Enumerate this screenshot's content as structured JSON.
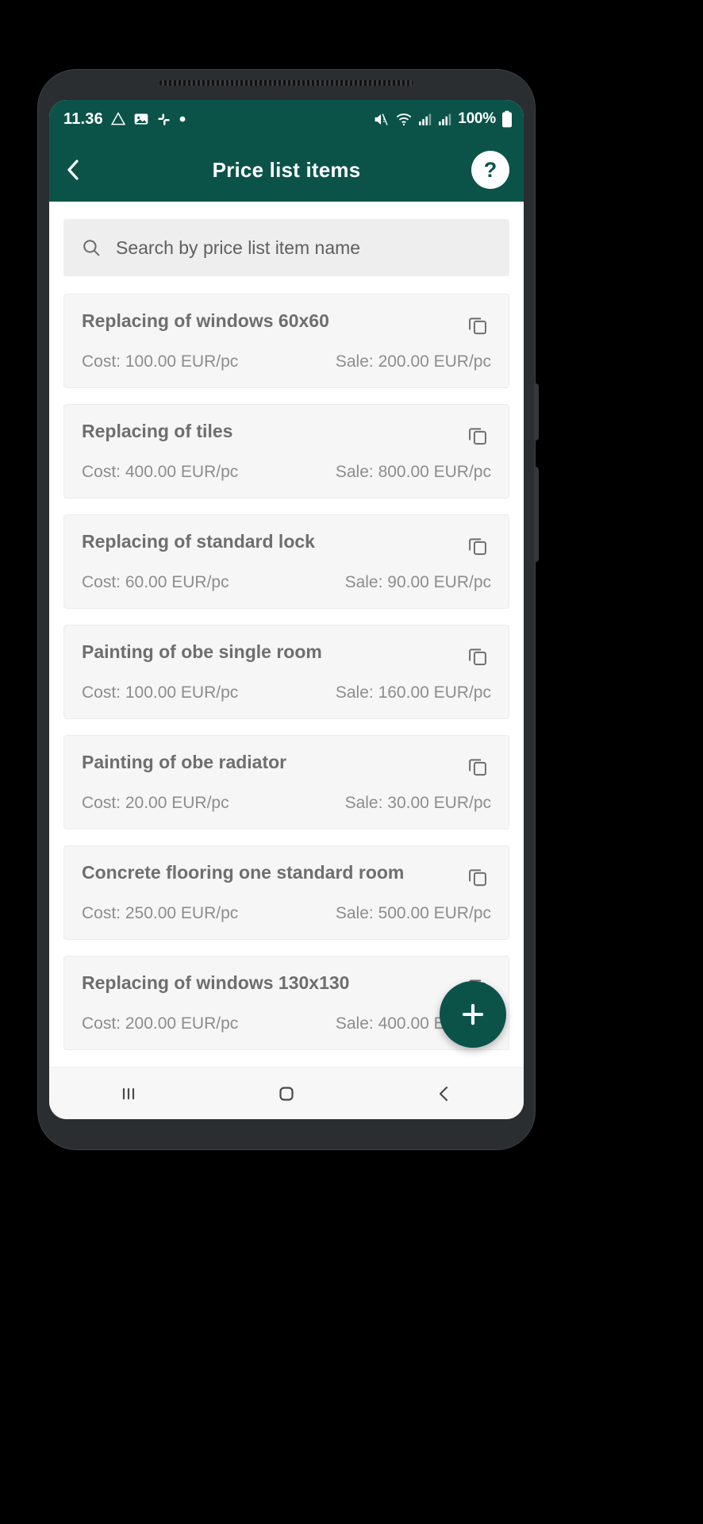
{
  "status_bar": {
    "clock": "11.36",
    "battery_percent": "100%",
    "left_icons": [
      "drive-icon",
      "photos-icon",
      "slack-icon",
      "dot-icon"
    ],
    "right_icons": [
      "mute-icon",
      "wifi-icon",
      "signal-1-icon",
      "signal-2-icon",
      "battery-icon"
    ]
  },
  "app_bar": {
    "back_icon": "chevron-left-icon",
    "title": "Price list items",
    "help_label": "?"
  },
  "search": {
    "icon": "search-icon",
    "placeholder": "Search by price list item name"
  },
  "items": [
    {
      "name": "Replacing of windows 60x60",
      "cost": "Cost: 100.00 EUR/pc",
      "sale": "Sale: 200.00 EUR/pc"
    },
    {
      "name": "Replacing of tiles",
      "cost": "Cost: 400.00 EUR/pc",
      "sale": "Sale: 800.00 EUR/pc"
    },
    {
      "name": "Replacing of standard lock",
      "cost": "Cost: 60.00 EUR/pc",
      "sale": "Sale: 90.00 EUR/pc"
    },
    {
      "name": "Painting of obe single room",
      "cost": "Cost: 100.00 EUR/pc",
      "sale": "Sale: 160.00 EUR/pc"
    },
    {
      "name": "Painting of obe radiator",
      "cost": "Cost: 20.00 EUR/pc",
      "sale": "Sale: 30.00 EUR/pc"
    },
    {
      "name": "Concrete flooring one standard room",
      "cost": "Cost: 250.00 EUR/pc",
      "sale": "Sale: 500.00 EUR/pc"
    },
    {
      "name": "Replacing of windows 130x130",
      "cost": "Cost: 200.00 EUR/pc",
      "sale": "Sale: 400.00 EUR/pc"
    }
  ],
  "fab": {
    "icon": "plus-icon",
    "label": "+"
  },
  "nav_bar": {
    "recents_icon": "recents-icon",
    "home_icon": "home-icon",
    "back_icon": "back-icon"
  },
  "colors": {
    "brand_green": "#0b5349",
    "card_bg": "#f6f6f6",
    "search_bg": "#eeeeee",
    "title_text": "#6e6e6e",
    "price_text": "#8d8d8d"
  }
}
